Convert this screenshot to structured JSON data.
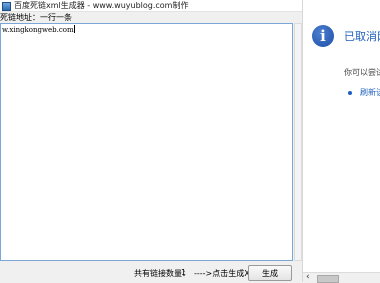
{
  "window": {
    "title": "百度死链xml生成器 - www.wuyublog.com制作"
  },
  "form": {
    "label": "死链地址：一行一条",
    "textarea_value": "w.xingkongweb.com"
  },
  "footer": {
    "count_label": "共有链接数量：",
    "count_value": "1",
    "hint": "---->点击生成XML",
    "generate_button": "生成"
  },
  "panel": {
    "icon": "info-icon",
    "title": "已取消网",
    "description": "你可以尝试",
    "link": "刷新该"
  },
  "colors": {
    "accent": "#1f5fbf",
    "textarea_border": "#7aa7d6"
  }
}
